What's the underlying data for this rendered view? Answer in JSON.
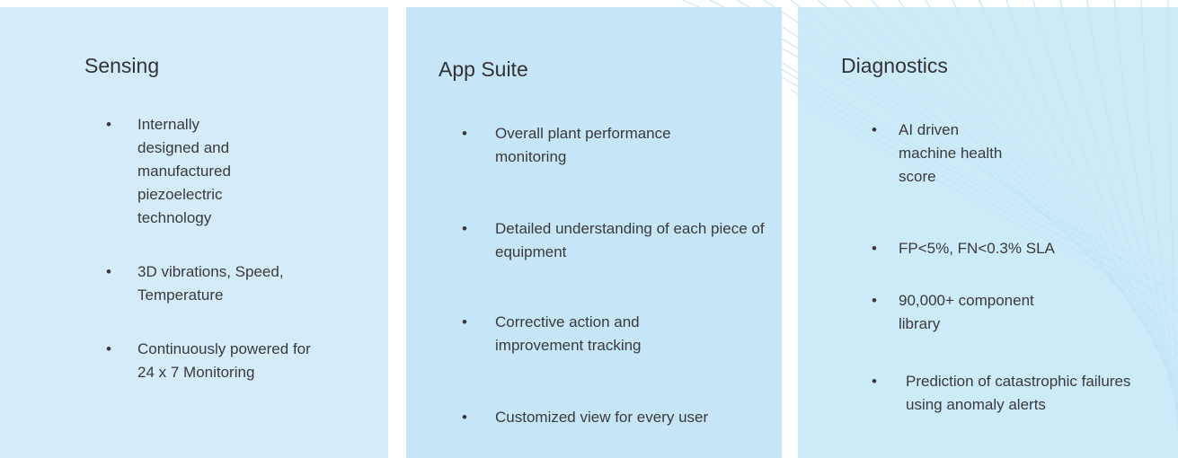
{
  "panels": [
    {
      "title": "Sensing",
      "bullets": [
        "Internally designed and manufactured piezoelectric technology",
        "3D vibrations, Speed, Temperature",
        "Continuously powered for 24 x 7 Monitoring"
      ]
    },
    {
      "title": "App Suite",
      "bullets": [
        "Overall plant performance monitoring",
        "Detailed understanding of each piece of equipment",
        "Corrective action and improvement tracking",
        "Customized view for every user"
      ]
    },
    {
      "title": "Diagnostics",
      "bullets": [
        "AI driven machine health score",
        "FP<5%, FN<0.3% SLA",
        "90,000+ component library",
        "Prediction of catastrophic failures using anomaly alerts"
      ]
    }
  ],
  "bullet_glyph": "•",
  "colors": {
    "panel_sensing": "#d4ecf9",
    "panel_app_suite": "#c6e6f8",
    "panel_diagnostics": "#c2e5f8",
    "decorative_lines": "#9fd3ee",
    "text": "#3a3a3a"
  }
}
